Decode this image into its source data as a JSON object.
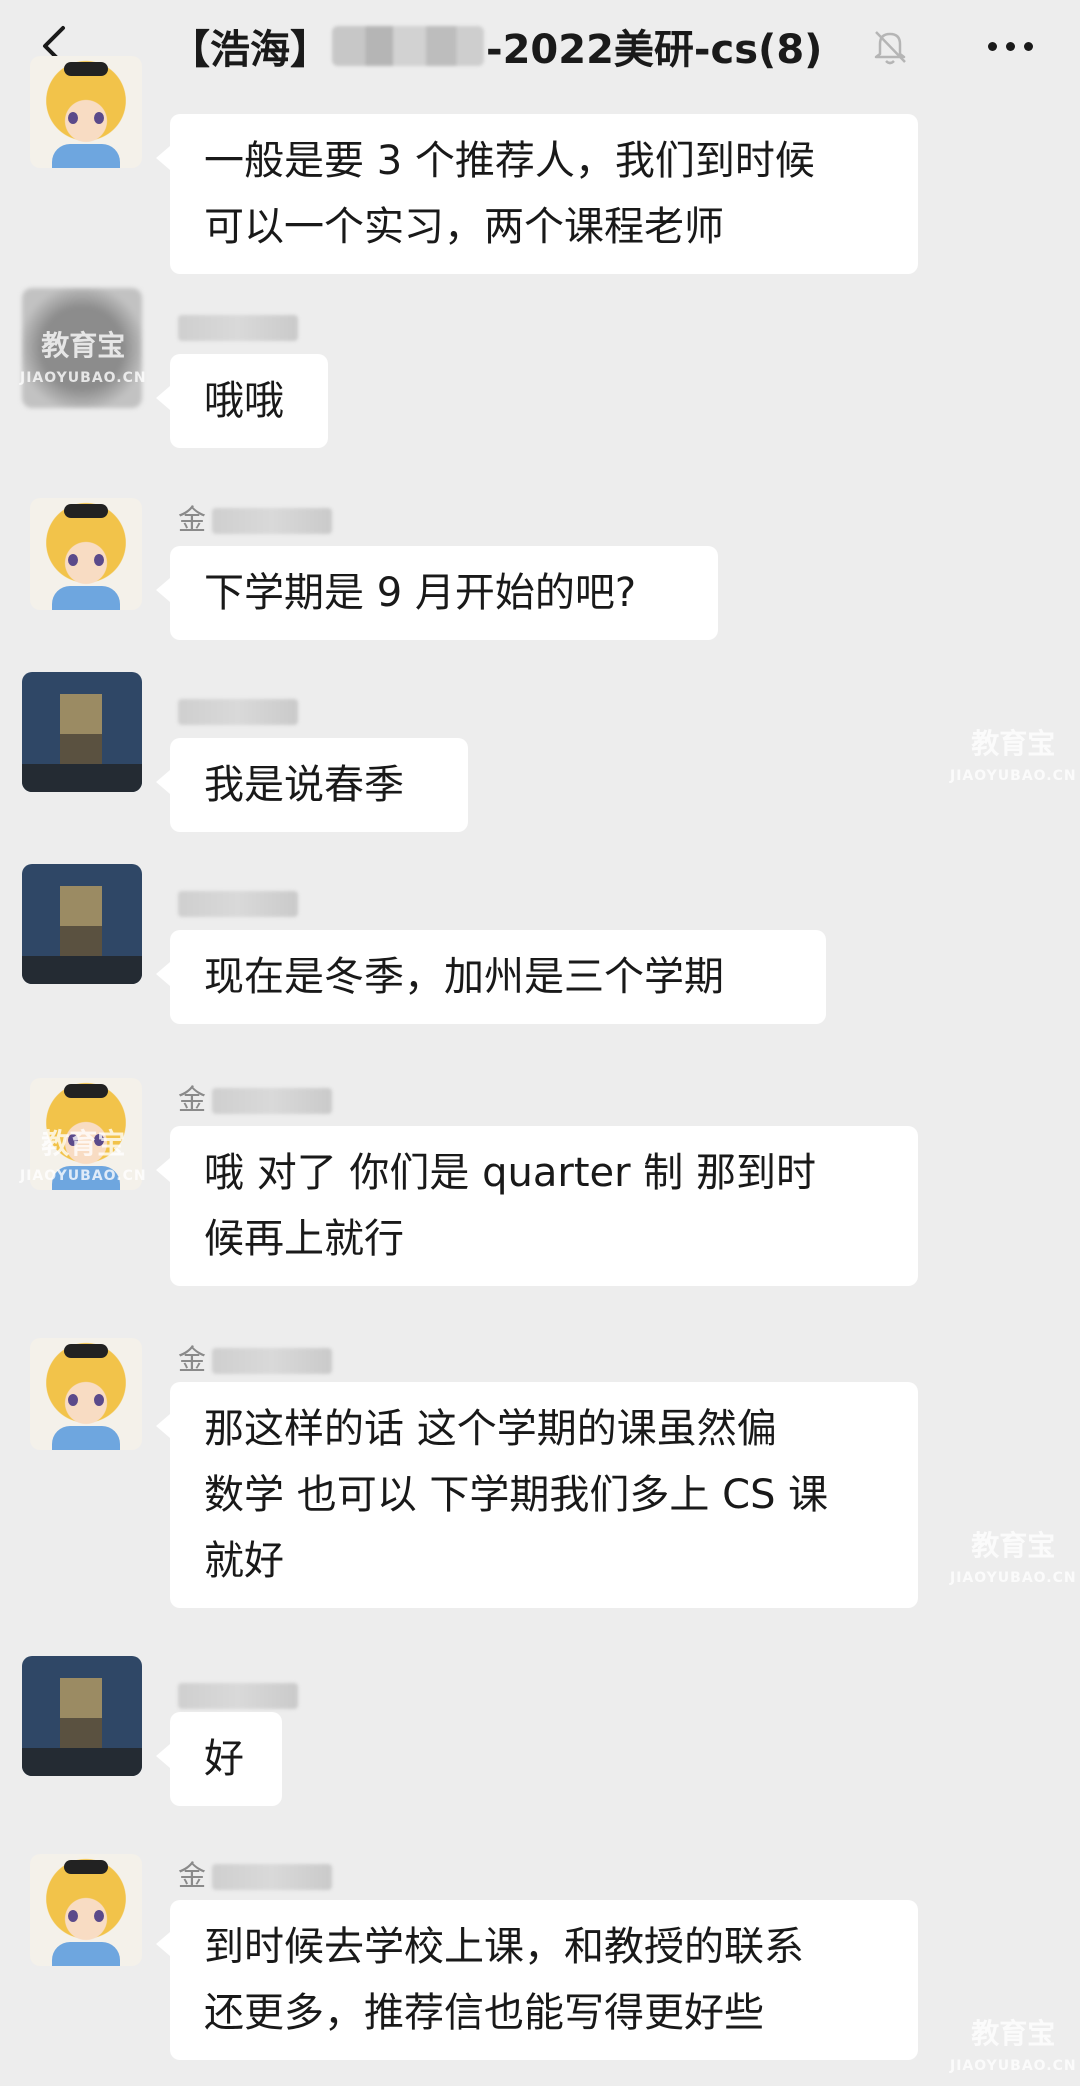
{
  "header": {
    "title_prefix": "【浩海】",
    "title_suffix": "-2022美研-cs(8)",
    "back_icon": "chevron-left-icon",
    "mute_icon": "bell-off-icon",
    "more_icon": "more-horizontal-icon"
  },
  "messages": [
    {
      "sender": "",
      "text": "一般是要 3 个推荐人，我们到时候\n可以一个实习，两个课程老师"
    },
    {
      "sender": "",
      "text": "哦哦"
    },
    {
      "sender": "金",
      "text": "下学期是 9 月开始的吧?"
    },
    {
      "sender": "",
      "text": "我是说春季"
    },
    {
      "sender": "",
      "text": "现在是冬季，加州是三个学期"
    },
    {
      "sender": "金",
      "text": "哦 对了 你们是 quarter 制 那到时\n候再上就行"
    },
    {
      "sender": "金",
      "text": "那这样的话 这个学期的课虽然偏\n数学 也可以 下学期我们多上 CS 课\n就好"
    },
    {
      "sender": "",
      "text": "好"
    },
    {
      "sender": "金",
      "text": "到时候去学校上课，和教授的联系\n还更多，推荐信也能写得更好些"
    }
  ],
  "watermark": {
    "brand": "教育宝",
    "domain": "JIAOYUBAO.CN"
  }
}
